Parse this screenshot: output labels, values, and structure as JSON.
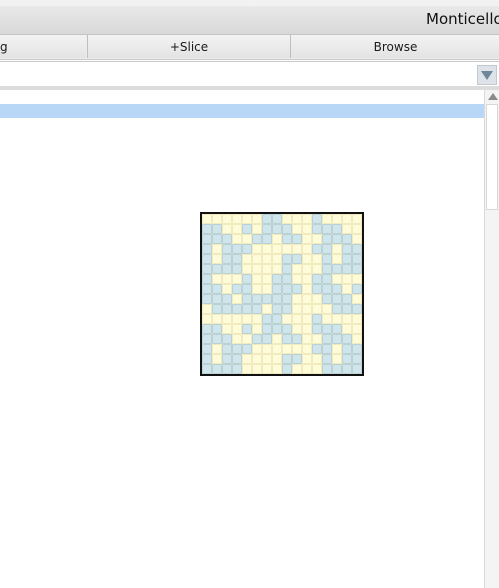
{
  "window": {
    "title": "Monticello"
  },
  "toolbar": {
    "buttons": [
      {
        "label": "g"
      },
      {
        "label": "+Slice"
      },
      {
        "label": "Browse"
      }
    ]
  },
  "package_selector": {
    "value": ""
  },
  "thumbnail": {
    "colors": {
      "light": "#fefbd8",
      "blue": "#cfe5ec"
    },
    "cells": [
      [
        0,
        0,
        0,
        0,
        0,
        0,
        1,
        1,
        0,
        0,
        0,
        1
      ],
      [
        1,
        1,
        0,
        0,
        1,
        0,
        1,
        1,
        1,
        0,
        0,
        1
      ],
      [
        1,
        1,
        1,
        0,
        0,
        1,
        1,
        0,
        1,
        1,
        0,
        0
      ],
      [
        1,
        0,
        1,
        1,
        1,
        0,
        0,
        0,
        0,
        0,
        0,
        1
      ],
      [
        1,
        0,
        1,
        1,
        0,
        0,
        0,
        0,
        1,
        1,
        0,
        0
      ],
      [
        1,
        1,
        1,
        1,
        0,
        0,
        0,
        0,
        1,
        0,
        0,
        0
      ],
      [
        1,
        0,
        0,
        0,
        1,
        0,
        0,
        1,
        1,
        0,
        0,
        1
      ],
      [
        1,
        1,
        0,
        1,
        1,
        0,
        0,
        1,
        1,
        1,
        0,
        1
      ],
      [
        1,
        1,
        1,
        0,
        1,
        1,
        1,
        1,
        1,
        0,
        0,
        0
      ],
      [
        0,
        1,
        1,
        1,
        1,
        1,
        0,
        1,
        1,
        0,
        0,
        0
      ]
    ]
  }
}
